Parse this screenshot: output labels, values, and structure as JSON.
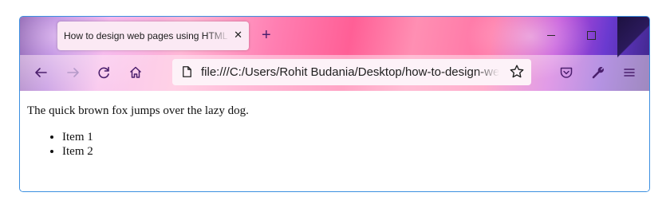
{
  "tab": {
    "title": "How to design web pages using HTML",
    "close_glyph": "✕",
    "new_tab_glyph": "+"
  },
  "window_controls": {
    "close_glyph": "✕"
  },
  "navigation": {
    "icons": [
      "arrow-left-icon",
      "arrow-right-icon",
      "reload-icon",
      "home-icon"
    ]
  },
  "address_bar": {
    "url": "file:///C:/Users/Rohit Budania/Desktop/how-to-design-web-pages-using-html.html"
  },
  "toolbar_right": {
    "icons": [
      "pocket-icon",
      "wrench-icon",
      "hamburger-menu-icon"
    ]
  },
  "page": {
    "paragraph": "The quick brown fox jumps over the lazy dog.",
    "list_items": [
      "Item 1",
      "Item 2"
    ]
  },
  "colors": {
    "window_border": "#3b8fe0",
    "tab_background": "#fbe9f4",
    "nav_icon": "#4b1f6d"
  }
}
